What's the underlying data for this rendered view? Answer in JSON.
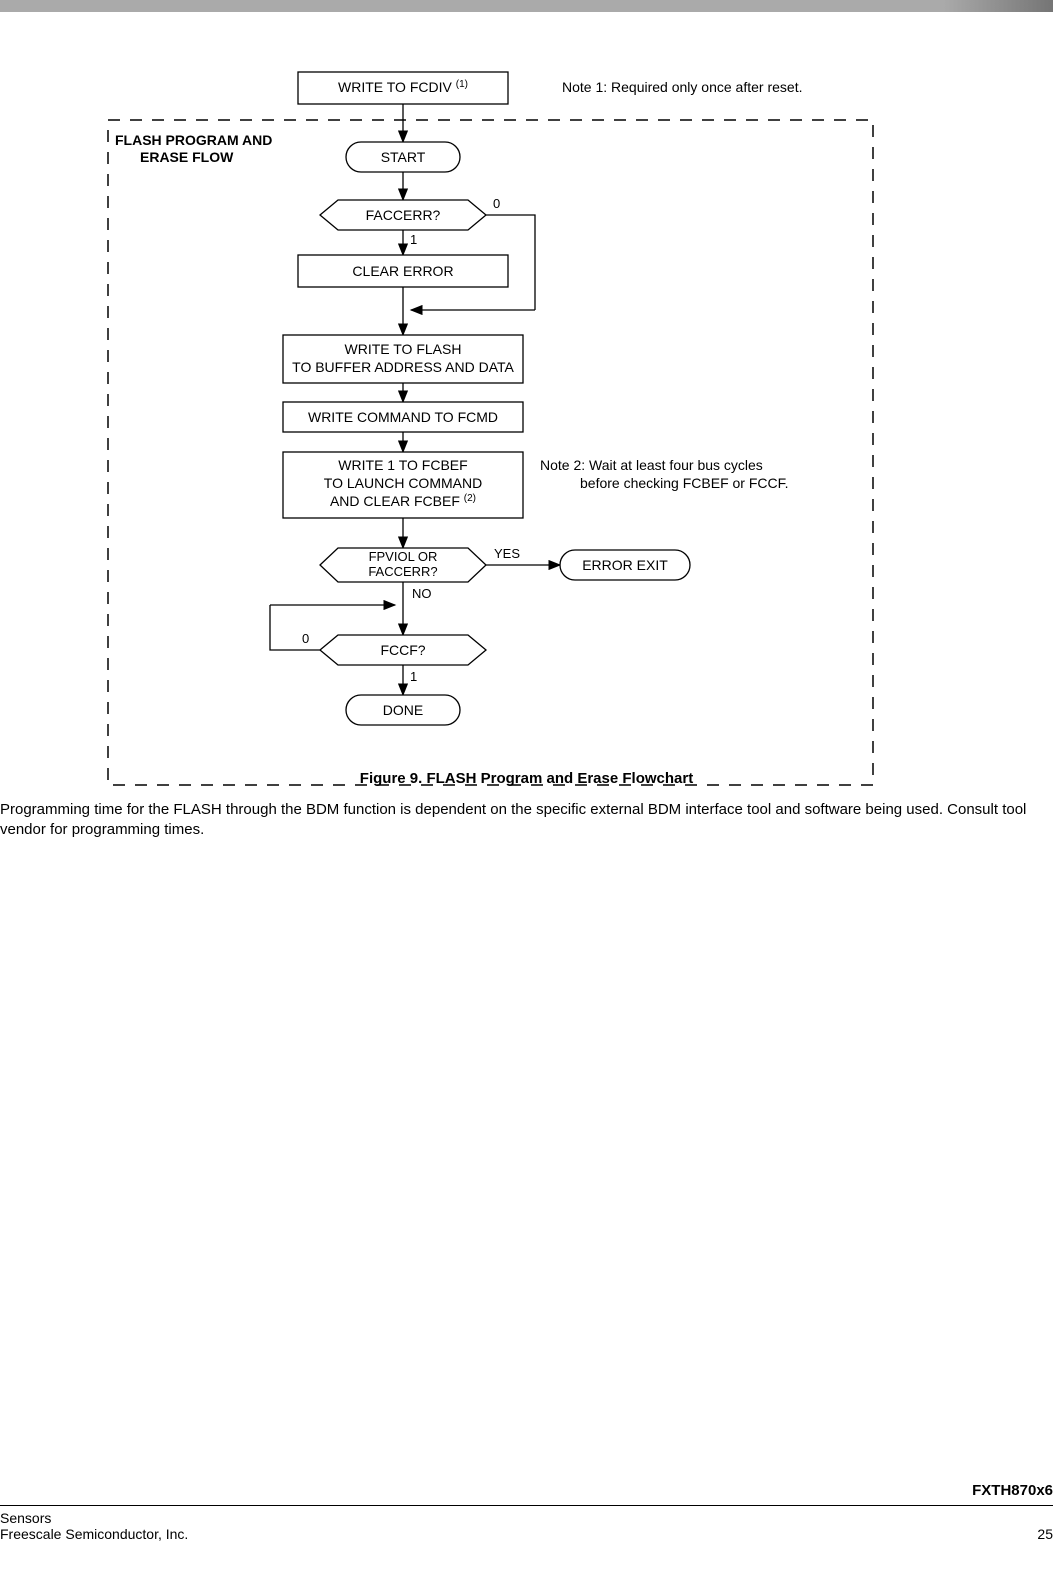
{
  "topbar": {},
  "figure": {
    "caption": "Figure 9. FLASH Program and Erase Flowchart",
    "sectionLabel1": "FLASH PROGRAM AND",
    "sectionLabel2": "ERASE FLOW",
    "note1": "Note 1: Required only once after reset.",
    "note2a": "Note 2: Wait at least four bus cycles",
    "note2b": "before checking FCBEF or FCCF.",
    "boxes": {
      "writeFcdiv": "WRITE TO FCDIV",
      "writeFcdivSup": "(1)",
      "start": "START",
      "faccerr": "FACCERR?",
      "clearError": "CLEAR ERROR",
      "writeFlash1": "WRITE TO FLASH",
      "writeFlash2": "TO BUFFER ADDRESS AND DATA",
      "writeCmd": "WRITE COMMAND TO FCMD",
      "launch1": "WRITE 1 TO FCBEF",
      "launch2": "TO LAUNCH COMMAND",
      "launch3a": "AND CLEAR FCBEF",
      "launch3sup": "(2)",
      "fpviol1": "FPVIOL OR",
      "fpviol2": "FACCERR?",
      "errorExit": "ERROR EXIT",
      "fccf": "FCCF?",
      "done": "DONE"
    },
    "labels": {
      "yes": "YES",
      "no": "NO",
      "zero": "0",
      "one": "1"
    }
  },
  "paragraph": "Programming time for the FLASH through the BDM function is dependent on the specific external BDM interface tool and software being used. Consult tool vendor for programming times.",
  "footer": {
    "product": "FXTH870x6",
    "leftTop": "Sensors",
    "leftBottom": "Freescale Semiconductor, Inc.",
    "pageNum": "25"
  }
}
